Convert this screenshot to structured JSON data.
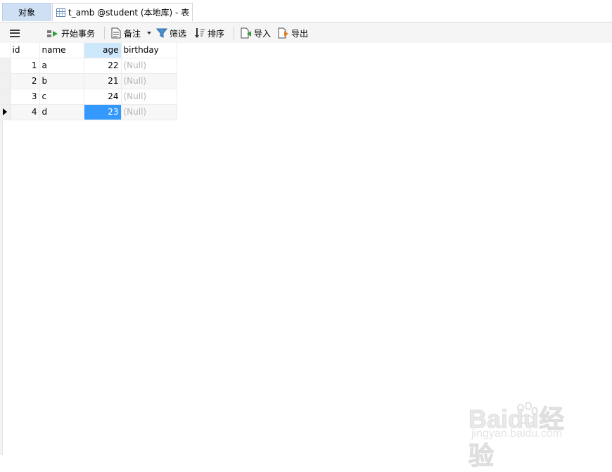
{
  "tabs": {
    "objects_label": "对象",
    "table_tab_label": "t_amb @student (本地库) - 表"
  },
  "toolbar": {
    "begin_transaction": "开始事务",
    "comment": "备注",
    "filter": "筛选",
    "sort": "排序",
    "import": "导入",
    "export": "导出"
  },
  "grid": {
    "columns": [
      "id",
      "name",
      "age",
      "birthday"
    ],
    "rows": [
      {
        "id": "1",
        "name": "a",
        "age": "22",
        "birthday": "(Null)"
      },
      {
        "id": "2",
        "name": "b",
        "age": "21",
        "birthday": "(Null)"
      },
      {
        "id": "3",
        "name": "c",
        "age": "24",
        "birthday": "(Null)"
      },
      {
        "id": "4",
        "name": "d",
        "age": "23",
        "birthday": "(Null)"
      }
    ],
    "selected_row": 4,
    "selected_column": "age"
  },
  "watermark": {
    "logo": "Baidu经验",
    "url": "jingyan.baidu.com"
  },
  "colors": {
    "accent": "#3399ff",
    "tab_active": "#cfe0f5",
    "header_selected": "#cde8fb"
  },
  "icons": [
    "menu-icon",
    "begin-transaction-icon",
    "comment-icon",
    "dropdown-icon",
    "filter-icon",
    "sort-icon",
    "import-icon",
    "export-icon",
    "table-icon",
    "row-pointer-icon"
  ]
}
